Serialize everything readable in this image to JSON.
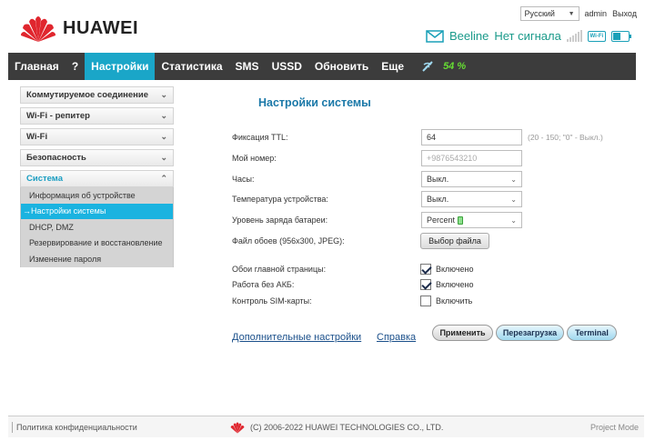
{
  "header": {
    "language": "Русский",
    "user": "admin",
    "logout": "Выход",
    "brand": "HUAWEI",
    "operator": "Beeline",
    "signal_status": "Нет сигнала",
    "wifi_badge": "Wi-Fi",
    "mail_icon": "envelope-icon",
    "accent_color": "#1aa6c8"
  },
  "nav": {
    "items": [
      "Главная",
      "?",
      "Настройки",
      "Статистика",
      "SMS",
      "USSD",
      "Обновить",
      "Еще"
    ],
    "active": "Настройки",
    "battery_percent": "54 %",
    "net_icon": "signal-icon"
  },
  "sidebar": {
    "sections": [
      "Коммутируемое соединение",
      "Wi-Fi - репитер",
      "Wi-Fi",
      "Безопасность"
    ],
    "open_section": "Система",
    "sub_items": [
      "Информация об устройстве",
      "→Настройки системы",
      "DHCP, DMZ",
      "Резервирование и восстановление",
      "Изменение пароля"
    ]
  },
  "content": {
    "title": "Настройки системы",
    "ttl": {
      "label": "Фиксация TTL:",
      "value": "64",
      "hint": "(20 - 150; \"0\" - Выкл.)"
    },
    "phone": {
      "label": "Мой номер:",
      "placeholder": "+9876543210"
    },
    "clock": {
      "label": "Часы:",
      "value": "Выкл."
    },
    "temperature": {
      "label": "Температура устройства:",
      "value": "Выкл."
    },
    "battery_level": {
      "label": "Уровень заряда батареи:",
      "value": "Percent"
    },
    "wallpaper": {
      "label": "Файл обоев (956x300, JPEG):",
      "button": "Выбор файла"
    },
    "main_wallpaper": {
      "label": "Обои главной страницы:",
      "text": "Включено",
      "checked": true
    },
    "no_battery": {
      "label": "Работа без АКБ:",
      "text": "Включено",
      "checked": true
    },
    "sim_control": {
      "label": "Контроль SIM-карты:",
      "text": "Включить",
      "checked": false
    },
    "advanced_link": "Дополнительные настройки",
    "help_link": "Справка",
    "apply_button": "Применить",
    "reboot_button": "Перезагрузка",
    "terminal_button": "Terminal"
  },
  "footer": {
    "privacy": "Политика конфиденциальности",
    "copyright": "(C) 2006-2022 HUAWEI TECHNOLOGIES CO., LTD.",
    "right_text": "Project Mode"
  }
}
